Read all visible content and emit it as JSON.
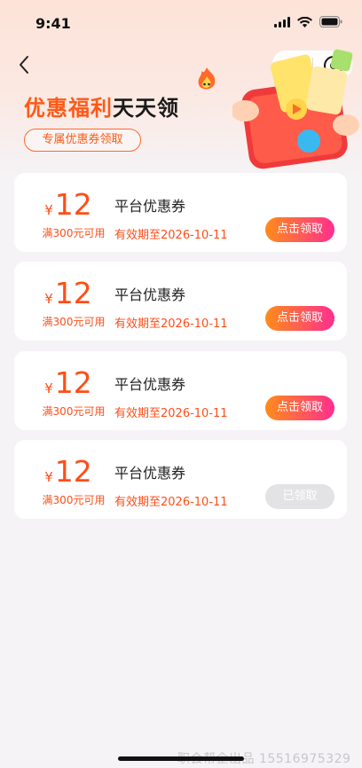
{
  "status_bar": {
    "time": "9:41"
  },
  "header": {
    "title_highlight": "优惠福利",
    "title_rest": "天天领",
    "tag": "专属优惠券领取"
  },
  "coupons": [
    {
      "currency": "¥",
      "amount": "12",
      "condition": "满300元可用",
      "title": "平台优惠券",
      "validity": "有效期至2026-10-11",
      "button": "点击领取",
      "state": "active"
    },
    {
      "currency": "¥",
      "amount": "12",
      "condition": "满300元可用",
      "title": "平台优惠券",
      "validity": "有效期至2026-10-11",
      "button": "点击领取",
      "state": "active"
    },
    {
      "currency": "¥",
      "amount": "12",
      "condition": "满300元可用",
      "title": "平台优惠券",
      "validity": "有效期至2026-10-11",
      "button": "点击领取",
      "state": "active"
    },
    {
      "currency": "¥",
      "amount": "12",
      "condition": "满300元可用",
      "title": "平台优惠券",
      "validity": "有效期至2026-10-11",
      "button": "已领取",
      "state": "claimed"
    }
  ],
  "watermark": "职会帮企出品 15516975329",
  "colors": {
    "accent": "#ff5a17",
    "button_gradient_start": "#ff8c1a",
    "button_gradient_end": "#ff2f8e",
    "disabled": "#e3e3e5",
    "page_bg": "#f5f3f6"
  }
}
